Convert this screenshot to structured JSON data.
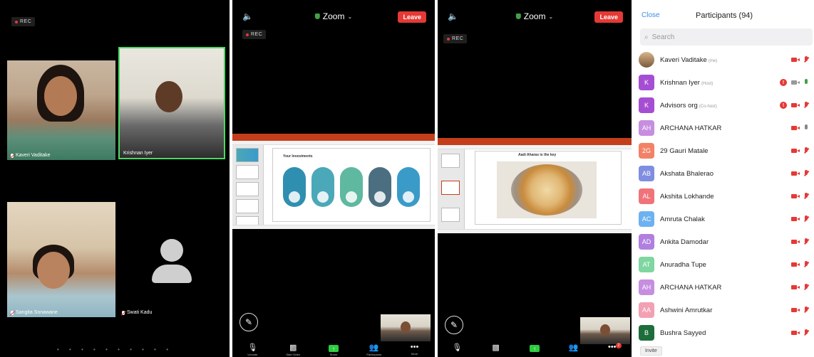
{
  "panel1": {
    "rec": "REC",
    "tiles": [
      {
        "name": "Kaveri Vaditake"
      },
      {
        "name": "Krishnan Iyer"
      },
      {
        "name": "Sangita Sonawane"
      },
      {
        "name": "Swati Kadu"
      }
    ],
    "page_dots": "• • • • • • • • • •"
  },
  "panel2": {
    "rec": "REC",
    "speaker_icon": "speaker-icon",
    "title": "Zoom",
    "chevron": "⌄",
    "leave": "Leave",
    "slide_title": "Your Investments",
    "pill_colors": [
      "#2f8fb0",
      "#4aa8b8",
      "#5fb8a0",
      "#4b6f80",
      "#3a9bc9"
    ],
    "toolbar": [
      {
        "icon": "mic-icon",
        "glyph": "🎙",
        "label": "Unmute"
      },
      {
        "icon": "video-icon",
        "glyph": "▩",
        "label": "Start Video"
      },
      {
        "icon": "share-icon",
        "glyph": "↑",
        "label": "Share"
      },
      {
        "icon": "participants-icon",
        "glyph": "👥",
        "label": "Participants"
      },
      {
        "icon": "more-icon",
        "glyph": "•••",
        "label": "More"
      }
    ]
  },
  "panel3": {
    "speaker_icon": "speaker-icon",
    "title": "Zoom",
    "chevron": "⌄",
    "leave": "Leave",
    "rec": "REC",
    "slide_title": "Aadi Aharas is the key",
    "toolbar": [
      {
        "icon": "mic-icon",
        "glyph": "🎙",
        "label": ""
      },
      {
        "icon": "video-icon",
        "glyph": "▩",
        "label": ""
      },
      {
        "icon": "share-icon",
        "glyph": "↑",
        "label": ""
      },
      {
        "icon": "participants-icon",
        "glyph": "👥",
        "label": ""
      },
      {
        "icon": "more-icon",
        "glyph": "•••",
        "label": "",
        "badge": "2"
      }
    ]
  },
  "participants": {
    "close": "Close",
    "title": "Participants (94)",
    "search_placeholder": "Search",
    "invite": "Invite",
    "rows": [
      {
        "initials": "",
        "name": "Kaveri Vaditake",
        "role": "(me)",
        "color": "#c79a6a",
        "photo": true,
        "alert": false,
        "video": "off",
        "mic": "off"
      },
      {
        "initials": "K",
        "name": "Krishnan Iyer",
        "role": "(Host)",
        "color": "#a64ed3",
        "photo": false,
        "alert": true,
        "video": "on",
        "mic": "on"
      },
      {
        "initials": "K",
        "name": "Advisors org",
        "role": "(Co-host)",
        "color": "#a64ed3",
        "photo": false,
        "alert": true,
        "video": "off",
        "mic": "off"
      },
      {
        "initials": "AH",
        "name": "ARCHANA HATKAR",
        "role": "",
        "color": "#c68ee0",
        "photo": false,
        "alert": false,
        "video": "off",
        "mic": "grey"
      },
      {
        "initials": "2G",
        "name": "29 Gauri Matale",
        "role": "",
        "color": "#f28266",
        "photo": false,
        "alert": false,
        "video": "off",
        "mic": "off"
      },
      {
        "initials": "AB",
        "name": "Akshata Bhalerao",
        "role": "",
        "color": "#7f8ee0",
        "photo": false,
        "alert": false,
        "video": "off",
        "mic": "off"
      },
      {
        "initials": "AL",
        "name": "Akshita Lokhande",
        "role": "",
        "color": "#f0737a",
        "photo": false,
        "alert": false,
        "video": "off",
        "mic": "off"
      },
      {
        "initials": "AC",
        "name": "Amruta Chalak",
        "role": "",
        "color": "#6cb2f0",
        "photo": false,
        "alert": false,
        "video": "off",
        "mic": "off"
      },
      {
        "initials": "AD",
        "name": "Ankita Damodar",
        "role": "",
        "color": "#b07fe0",
        "photo": false,
        "alert": false,
        "video": "off",
        "mic": "off"
      },
      {
        "initials": "AT",
        "name": "Anuradha Tupe",
        "role": "",
        "color": "#7fd6a0",
        "photo": false,
        "alert": false,
        "video": "off",
        "mic": "off"
      },
      {
        "initials": "AH",
        "name": "ARCHANA HATKAR",
        "role": "",
        "color": "#c68ee0",
        "photo": false,
        "alert": false,
        "video": "off",
        "mic": "off"
      },
      {
        "initials": "AA",
        "name": "Ashwini Amrutkar",
        "role": "",
        "color": "#f2a0b4",
        "photo": false,
        "alert": false,
        "video": "off",
        "mic": "off"
      },
      {
        "initials": "B",
        "name": "Bushra Sayyed",
        "role": "",
        "color": "#1e6e3c",
        "photo": false,
        "alert": false,
        "video": "off",
        "mic": "off"
      }
    ]
  }
}
